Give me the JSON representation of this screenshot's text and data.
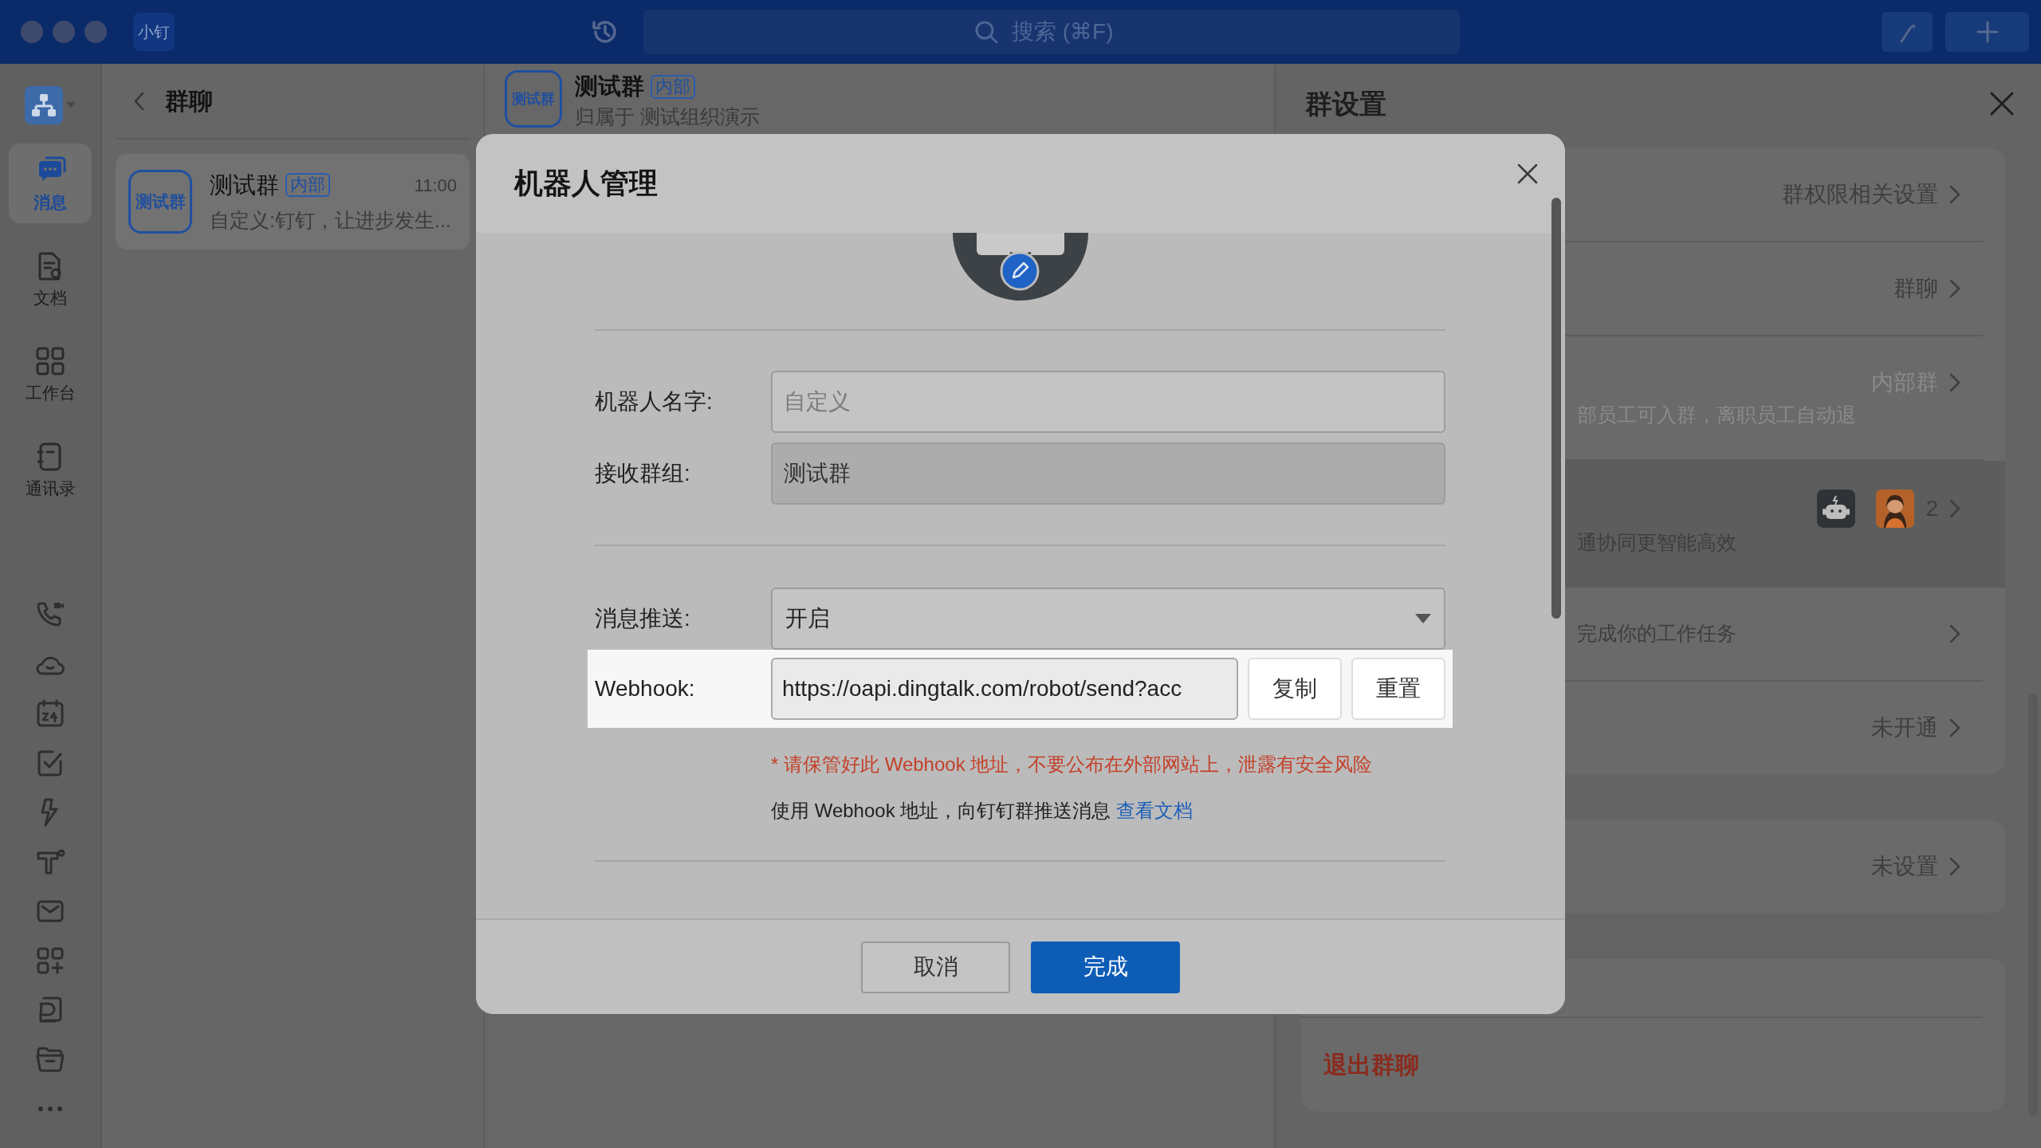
{
  "titlebar": {
    "app_badge": "小钉",
    "search": {
      "placeholder": "搜索 (⌘F)"
    }
  },
  "nav": {
    "items": [
      {
        "label": "消息",
        "selected": true
      },
      {
        "label": "文档",
        "selected": false
      },
      {
        "label": "工作台",
        "selected": false
      },
      {
        "label": "通讯录",
        "selected": false
      }
    ]
  },
  "chat_list": {
    "title": "群聊",
    "items": [
      {
        "avatar_text": "测试群",
        "name": "测试群",
        "tag": "内部",
        "time": "11:00",
        "preview": "自定义:钉钉，让进步发生...",
        "selected": true
      }
    ]
  },
  "chat_header": {
    "avatar_text": "测试群",
    "name": "测试群",
    "tag": "内部",
    "subtitle": "归属于 测试组织演示"
  },
  "settings": {
    "title": "群设置",
    "groups": [
      [
        {
          "kind": "link",
          "value": "群权限相关设置",
          "muted": false,
          "highlighted": false
        },
        {
          "kind": "link",
          "value": "群聊",
          "muted": false,
          "highlighted": false
        },
        {
          "kind": "link",
          "value": "内部群",
          "description": "部员工可入群，离职员工自动退",
          "muted": true,
          "highlighted": false
        },
        {
          "kind": "robots",
          "count": "2",
          "description": "通协同更智能高效",
          "muted": false,
          "highlighted": true
        },
        {
          "kind": "link",
          "description": "完成你的工作任务",
          "muted": false,
          "highlighted": false
        },
        {
          "kind": "link",
          "value": "未开通",
          "muted": false,
          "highlighted": false
        }
      ],
      [
        {
          "kind": "link",
          "value": "未设置",
          "muted": false,
          "highlighted": false
        }
      ],
      [
        {
          "kind": "blank",
          "highlighted": false
        },
        {
          "kind": "danger",
          "value": "退出群聊",
          "muted": false,
          "highlighted": false
        }
      ]
    ]
  },
  "modal": {
    "title": "机器人管理",
    "field_groups": [
      [
        {
          "kind": "input",
          "label": "机器人名字:",
          "placeholder": "自定义",
          "disabled": false
        },
        {
          "kind": "input",
          "label": "接收群组:",
          "value": "测试群",
          "disabled": true
        }
      ],
      [
        {
          "kind": "select",
          "label": "消息推送:",
          "value": "开启"
        },
        {
          "kind": "webhook",
          "label": "Webhook:",
          "value": "https://oapi.dingtalk.com/robot/send?acc",
          "buttons": [
            "复制",
            "重置"
          ],
          "highlighted": true
        }
      ]
    ],
    "warning": "* 请保管好此 Webhook 地址，不要公布在外部网站上，泄露有安全风险",
    "note": {
      "text": "使用 Webhook 地址，向钉钉群推送消息",
      "link": "查看文档"
    },
    "buttons": [
      {
        "label": "取消",
        "primary": false
      },
      {
        "label": "完成",
        "primary": true
      }
    ]
  }
}
